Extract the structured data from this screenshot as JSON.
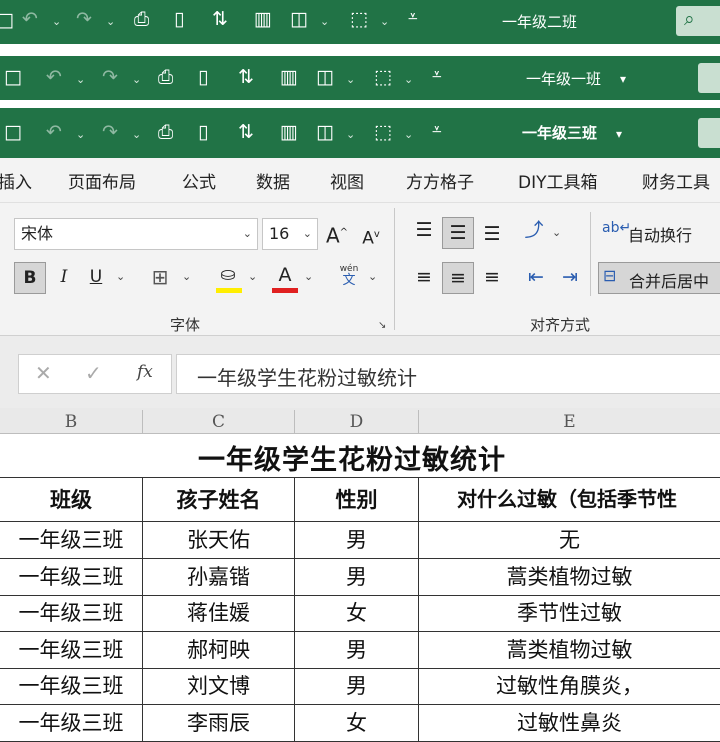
{
  "windows": [
    {
      "title": "一年级二班"
    },
    {
      "title": "一年级一班"
    },
    {
      "title": "一年级三班"
    }
  ],
  "ribbon": {
    "tabs": [
      "插入",
      "页面布局",
      "公式",
      "数据",
      "视图",
      "方方格子",
      "DIY工具箱",
      "财务工具"
    ],
    "font_name": "宋体",
    "font_size": "16",
    "bold": "B",
    "italic": "I",
    "underline": "U",
    "wen_top": "wén",
    "wen_bottom": "文",
    "wrap_text": "自动换行",
    "merge_center": "合并后居中",
    "group_font": "字体",
    "group_align": "对齐方式",
    "icons": [
      "undo-icon",
      "redo-icon",
      "print-preview-icon",
      "new-document-icon",
      "sort-icon",
      "chart-icon",
      "shapes-icon",
      "select-object-icon",
      "customize-icon",
      "search-icon"
    ]
  },
  "formula_bar": {
    "content": "一年级学生花粉过敏统计"
  },
  "columns": [
    "B",
    "C",
    "D",
    "E"
  ],
  "sheet": {
    "title": "一年级学生花粉过敏统计",
    "headers": [
      "班级",
      "孩子姓名",
      "性别",
      "对什么过敏（包括季节性"
    ],
    "rows": [
      [
        "一年级三班",
        "张天佑",
        "男",
        "无"
      ],
      [
        "一年级三班",
        "孙嘉锴",
        "男",
        "蒿类植物过敏"
      ],
      [
        "一年级三班",
        "蒋佳媛",
        "女",
        "季节性过敏"
      ],
      [
        "一年级三班",
        "郝柯映",
        "男",
        "蒿类植物过敏"
      ],
      [
        "一年级三班",
        "刘文博",
        "男",
        "过敏性角膜炎，"
      ],
      [
        "一年级三班",
        "李雨辰",
        "女",
        "过敏性鼻炎"
      ]
    ]
  }
}
